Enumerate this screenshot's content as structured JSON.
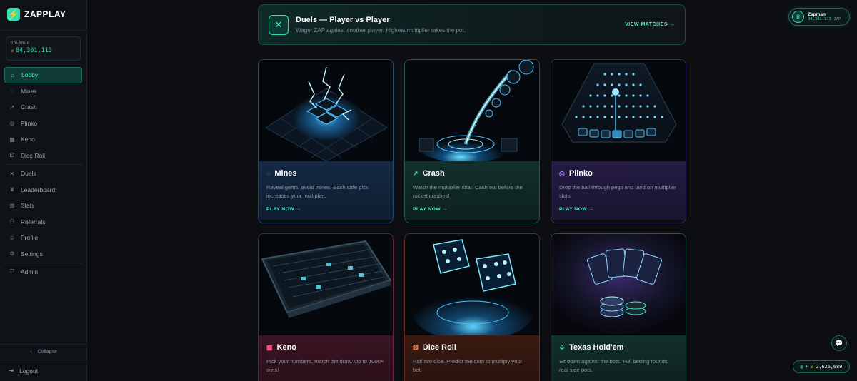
{
  "brand": {
    "name": "ZAPPLAY",
    "logo_icon": "⚡"
  },
  "balance": {
    "label": "BALANCE",
    "value": "84,301,113"
  },
  "nav": [
    {
      "label": "Lobby",
      "icon": "⌂",
      "active": true
    },
    {
      "label": "Mines",
      "icon": "◌"
    },
    {
      "label": "Crash",
      "icon": "↗"
    },
    {
      "label": "Plinko",
      "icon": "◎"
    },
    {
      "label": "Keno",
      "icon": "▦"
    },
    {
      "label": "Dice Roll",
      "icon": "⚄"
    },
    {
      "label": "Duels",
      "icon": "✕"
    },
    {
      "label": "Leaderboard",
      "icon": "♛"
    },
    {
      "label": "Stats",
      "icon": "▥"
    },
    {
      "label": "Referrals",
      "icon": "⚇"
    },
    {
      "label": "Profile",
      "icon": "☺"
    },
    {
      "label": "Settings",
      "icon": "⚙"
    },
    {
      "label": "Admin",
      "icon": "⛉"
    }
  ],
  "sidebar_bottom": {
    "collapse": "Collapse",
    "logout": "Logout"
  },
  "duels_banner": {
    "title": "Duels — Player vs Player",
    "subtitle": "Wager ZAP against another player. Highest multiplier takes the pot.",
    "action": "VIEW MATCHES →"
  },
  "user": {
    "name": "Zapman",
    "balance": "84,301,113",
    "currency": "ZAP"
  },
  "ticker": {
    "prefix": "+",
    "value": "2,626,689"
  },
  "games": {
    "mines": {
      "title": "Mines",
      "desc": "Reveal gems, avoid mines. Each safe pick increases your multiplier.",
      "cta": "PLAY NOW →"
    },
    "crash": {
      "title": "Crash",
      "desc": "Watch the multiplier soar. Cash out before the rocket crashes!",
      "cta": "PLAY NOW →"
    },
    "plinko": {
      "title": "Plinko",
      "desc": "Drop the ball through pegs and land on multiplier slots.",
      "cta": "PLAY NOW →"
    },
    "keno": {
      "title": "Keno",
      "desc": "Pick your numbers, match the draw. Up to 1000× wins!"
    },
    "dice": {
      "title": "Dice Roll",
      "desc": "Roll two dice. Predict the sum to multiply your bet."
    },
    "holdem": {
      "title": "Texas Hold'em",
      "desc": "Sit down against the bots. Full betting rounds, real side pots."
    }
  }
}
